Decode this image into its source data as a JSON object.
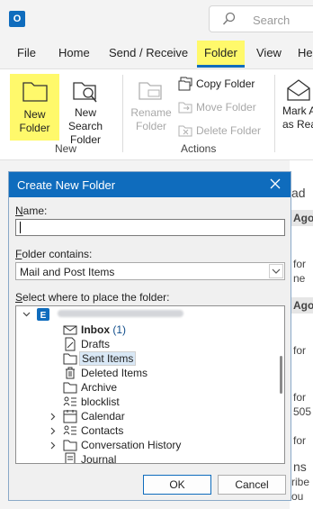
{
  "app": {
    "logo_letter": "O"
  },
  "search": {
    "placeholder": "Search"
  },
  "menu": [
    "File",
    "Home",
    "Send / Receive",
    "Folder",
    "View",
    "Help"
  ],
  "ribbon": {
    "new_folder": [
      "New",
      "Folder"
    ],
    "new_search_folder": [
      "New Search",
      "Folder"
    ],
    "group_new": "New",
    "rename_folder": [
      "Rename",
      "Folder"
    ],
    "copy_folder": "Copy Folder",
    "move_folder": "Move Folder",
    "delete_folder": "Delete Folder",
    "group_actions": "Actions",
    "mark_all": [
      "Mark A",
      "as Rea"
    ]
  },
  "background": {
    "ad": "ad",
    "ago1": "Ago",
    "for1": "for",
    "ne": "ne",
    "ago2": "Ago",
    "for2": "for",
    "for3": "for",
    "num": "505",
    "for4": "for",
    "ns": "ns",
    "ribe": "ribe",
    "ou": "ou"
  },
  "dialog": {
    "title": "Create New Folder",
    "name_label_u": "N",
    "name_label": "ame:",
    "name_value": "",
    "contains_label_u": "F",
    "contains_label": "older contains:",
    "contains_value": "Mail and Post Items",
    "place_label_u": "S",
    "place_label": "elect where to place the folder:",
    "ok": "OK",
    "cancel": "Cancel"
  },
  "tree": [
    {
      "label": "Inbox",
      "count": "(1)",
      "icon": "inbox-icon"
    },
    {
      "label": "Drafts",
      "icon": "drafts-icon"
    },
    {
      "label": "Sent Items",
      "icon": "folder-icon",
      "selected": true
    },
    {
      "label": "Deleted Items",
      "icon": "trash-icon"
    },
    {
      "label": "Archive",
      "icon": "folder-icon"
    },
    {
      "label": "blocklist",
      "icon": "contacts-folder-icon"
    },
    {
      "label": "Calendar",
      "icon": "calendar-icon",
      "expandable": true
    },
    {
      "label": "Contacts",
      "icon": "contacts-folder-icon",
      "expandable": true
    },
    {
      "label": "Conversation History",
      "icon": "folder-icon",
      "expandable": true
    },
    {
      "label": "Journal",
      "icon": "journal-icon"
    }
  ]
}
